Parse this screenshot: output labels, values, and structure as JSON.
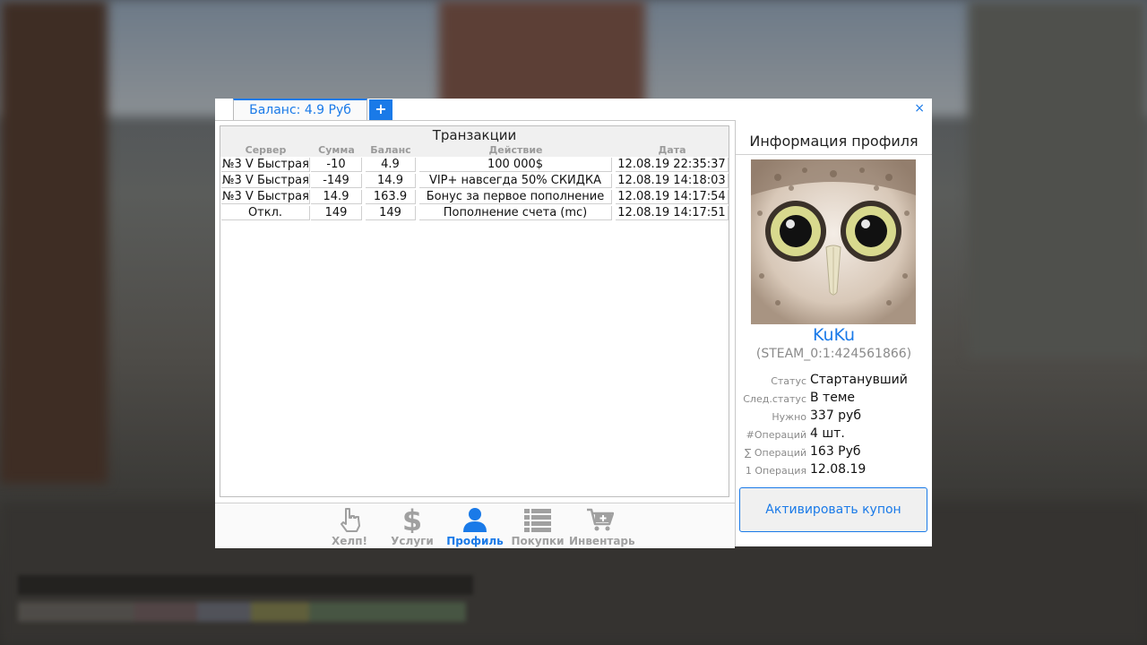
{
  "window": {
    "balance_tab": "Баланс: 4.9 Руб",
    "add_tab": "+",
    "close": "×"
  },
  "transactions": {
    "title": "Транзакции",
    "columns": [
      "Сервер",
      "Сумма",
      "Баланс",
      "Действие",
      "Дата"
    ],
    "rows": [
      [
        "№3 V Быстрая",
        "-10",
        "4.9",
        "100 000$",
        "12.08.19 22:35:37"
      ],
      [
        "№3 V Быстрая",
        "-149",
        "14.9",
        "VIP+ навсегда 50% СКИДКА",
        "12.08.19 14:18:03"
      ],
      [
        "№3 V Быстрая",
        "14.9",
        "163.9",
        "Бонус за первое пополнение",
        "12.08.19 14:17:54"
      ],
      [
        "Откл.",
        "149",
        "149",
        "Пополнение счета (mc)",
        "12.08.19 14:17:51"
      ]
    ]
  },
  "nav": {
    "items": [
      {
        "label": "Хелп!",
        "icon": "hand-pointer-icon",
        "active": false
      },
      {
        "label": "Услуги",
        "icon": "dollar-icon",
        "active": false
      },
      {
        "label": "Профиль",
        "icon": "user-icon",
        "active": true
      },
      {
        "label": "Покупки",
        "icon": "list-icon",
        "active": false
      },
      {
        "label": "Инвентарь",
        "icon": "cart-plus-icon",
        "active": false
      }
    ]
  },
  "profile": {
    "title": "Информация профиля",
    "username": "KuKu",
    "steam_id": "(STEAM_0:1:424561866)",
    "stats": [
      {
        "label": "Статус",
        "value": "Стартанувший"
      },
      {
        "label": "След.статус",
        "value": "В теме"
      },
      {
        "label": "Нужно",
        "value": "337 руб"
      },
      {
        "label": "#Операций",
        "value": "4 шт."
      },
      {
        "label": "∑ Операций",
        "value": "163 Руб"
      },
      {
        "label": "1 Операция",
        "value": "12.08.19"
      }
    ],
    "coupon_button": "Активировать купон"
  },
  "colors": {
    "accent": "#1a7ae8",
    "muted": "#a0a0a0"
  }
}
